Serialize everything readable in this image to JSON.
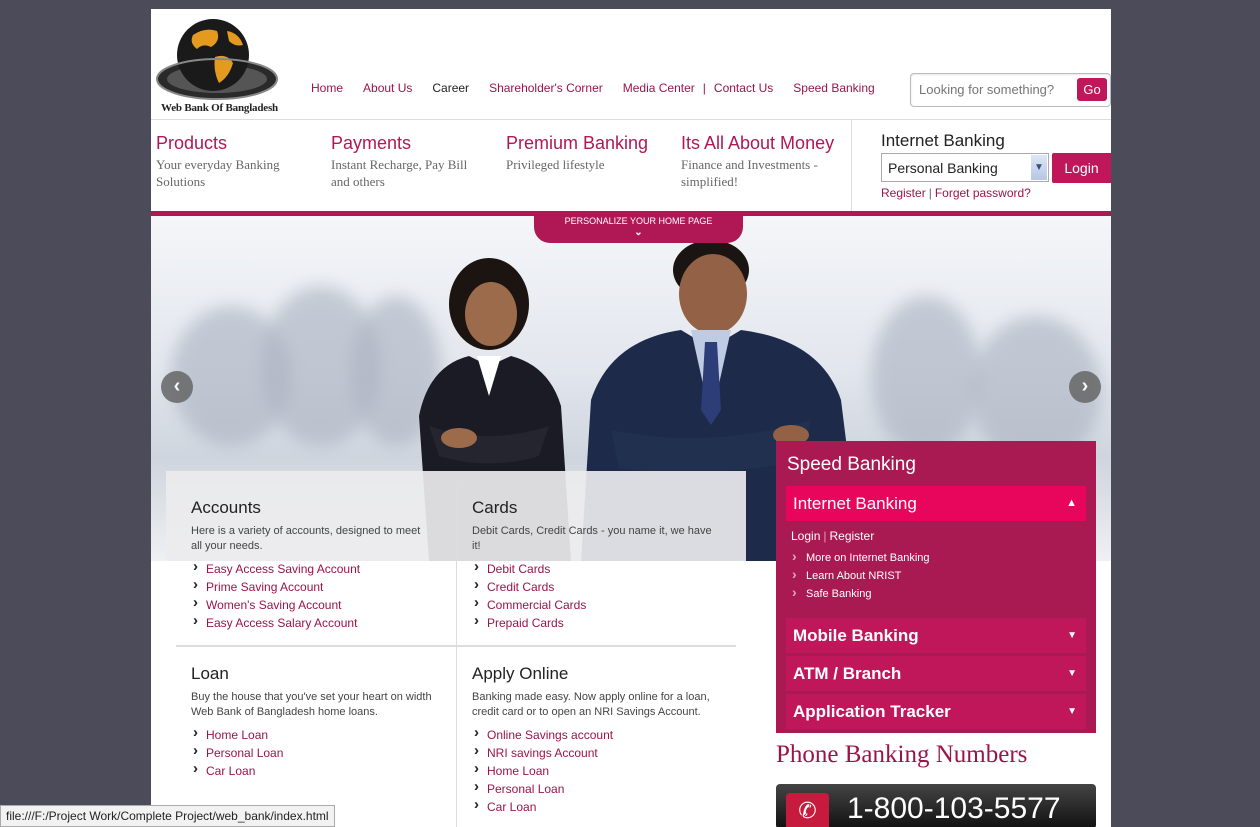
{
  "logo": {
    "text": "Web Bank Of Bangladesh"
  },
  "topnav": [
    "Home",
    "About Us",
    "Career",
    "Shareholder's Corner",
    "Media Center",
    "Contact Us",
    "Speed Banking"
  ],
  "search": {
    "placeholder": "Looking for something?",
    "button": "Go"
  },
  "features": [
    {
      "title": "Products",
      "desc": "Your everyday Banking Solutions"
    },
    {
      "title": "Payments",
      "desc": "Instant Recharge, Pay Bill and others"
    },
    {
      "title": "Premium Banking",
      "desc": "Privileged lifestyle"
    },
    {
      "title": "Its All About Money",
      "desc": "Finance and Investments - simplified!"
    }
  ],
  "internet_banking": {
    "title": "Internet Banking",
    "selected": "Personal Banking",
    "login": "Login",
    "register": "Register",
    "forget": "Forget password?"
  },
  "personalize": "PERSONALIZE YOUR HOME PAGE",
  "accounts": {
    "title": "Accounts",
    "desc": "Here is a variety of accounts, designed to meet all your needs.",
    "links": [
      "Easy Access Saving Account",
      "Prime Saving Account",
      "Women's Saving Account",
      "Easy Access Salary Account"
    ]
  },
  "cards": {
    "title": "Cards",
    "desc": "Debit Cards, Credit Cards - you name it, we have it!",
    "links": [
      "Debit Cards",
      "Credit Cards",
      "Commercial Cards",
      "Prepaid Cards"
    ]
  },
  "loan": {
    "title": "Loan",
    "desc": "Buy the house that you've set your heart on width Web Bank of Bangladesh home loans.",
    "links": [
      "Home Loan",
      "Personal Loan",
      "Car Loan"
    ]
  },
  "apply": {
    "title": "Apply Online",
    "desc": "Banking made easy. Now apply online for a loan, credit card or to open an NRI Savings Account.",
    "links": [
      "Online Savings account",
      "NRI savings Account",
      "Home Loan",
      "Personal Loan",
      "Car Loan"
    ]
  },
  "speed_banking": {
    "title": "Speed Banking",
    "open_section": "Internet Banking",
    "login": "Login",
    "register": "Register",
    "links": [
      "More on Internet Banking",
      "Learn About NRIST",
      "Safe Banking"
    ],
    "sections": [
      "Mobile Banking",
      "ATM / Branch",
      "Application Tracker"
    ]
  },
  "phone": {
    "title": "Phone Banking Numbers",
    "number": "1-800-103-5577"
  },
  "status_bar": "file:///F:/Project Work/Complete Project/web_bank/index.html",
  "colors": {
    "brand": "#b01855",
    "accent": "#e8065c"
  }
}
